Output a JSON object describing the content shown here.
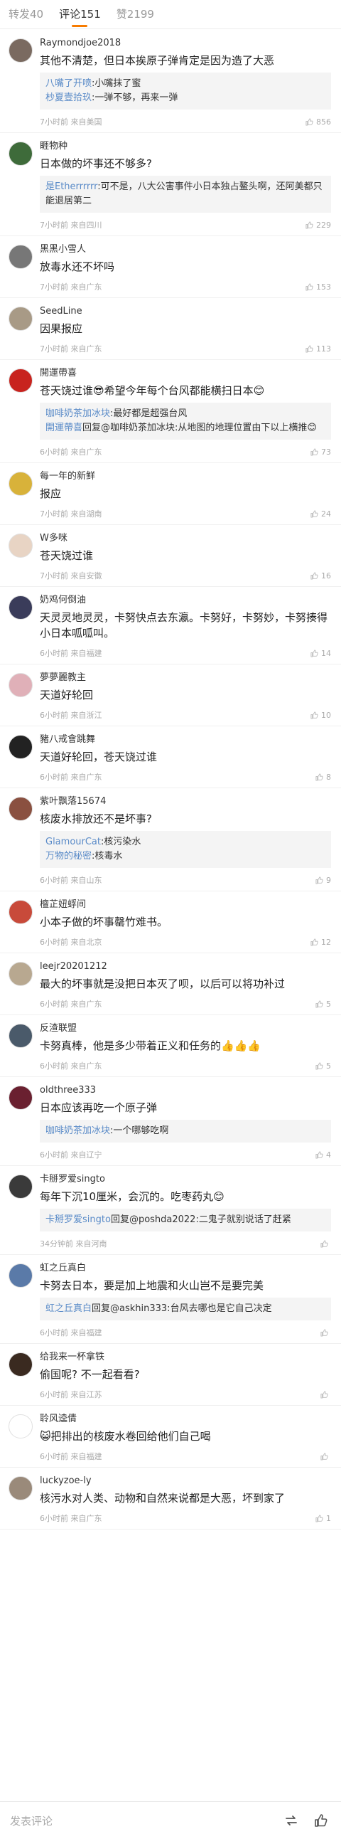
{
  "tabs": [
    {
      "label": "转发",
      "count": "40"
    },
    {
      "label": "评论",
      "count": "151"
    },
    {
      "label": "赞",
      "count": "2199"
    }
  ],
  "comments": [
    {
      "name": "Raymondjoe2018",
      "text": "其他不清楚，但日本挨原子弹肯定是因为造了大恶",
      "replies": [
        {
          "name": "八嘴了开喷",
          "text": ":小嘴抹了蜜"
        },
        {
          "name": "杪夏壹拾玖",
          "text": ":一弹不够，再来一弹"
        }
      ],
      "meta": "7小时前 来自美国",
      "likes": "856",
      "avatar_color": "#7a6a60"
    },
    {
      "name": "睚物种",
      "text": "日本做的坏事还不够多?",
      "replies": [
        {
          "name": "是Etherrrrrr",
          "text": ":可不是，八大公害事件小日本独占鳌头啊，还阿美都只能退居第二"
        }
      ],
      "meta": "7小时前 来自四川",
      "likes": "229",
      "avatar_color": "#3e6b3a"
    },
    {
      "name": "黑黑小雪人",
      "text": "放毒水还不坏吗",
      "replies": [],
      "meta": "7小时前 来自广东",
      "likes": "153",
      "avatar_color": "#777777"
    },
    {
      "name": "SeedLine",
      "text": "因果报应",
      "replies": [],
      "meta": "7小时前 来自广东",
      "likes": "113",
      "avatar_color": "#a89a86"
    },
    {
      "name": "開運帶喜",
      "text": "苍天饶过谁😎希望今年每个台风都能横扫日本😊",
      "replies": [
        {
          "name": "咖啡奶茶加冰块",
          "text": ":最好都是超强台风"
        },
        {
          "name": "開運帶喜",
          "text": "回复@咖啡奶茶加冰块:从地图的地理位置由下以上横推😊"
        }
      ],
      "meta": "6小时前 来自广东",
      "likes": "73",
      "avatar_color": "#c8231e"
    },
    {
      "name": "每一年的新鲜",
      "text": "报应",
      "replies": [],
      "meta": "7小时前 来自湖南",
      "likes": "24",
      "avatar_color": "#d8b23a"
    },
    {
      "name": "W多咪",
      "text": "苍天饶过谁",
      "replies": [],
      "meta": "7小时前 来自安徽",
      "likes": "16",
      "avatar_color": "#e8d4c4"
    },
    {
      "name": "奶鸡何倒油",
      "text": "天灵灵地灵灵，卡努快点去东瀛。卡努好，卡努妙，卡努揍得小日本呱呱叫。",
      "replies": [],
      "meta": "6小时前 来自福建",
      "likes": "14",
      "avatar_color": "#3a3c5a"
    },
    {
      "name": "夢夢麗教主",
      "text": "天道好轮回",
      "replies": [],
      "meta": "6小时前 来自浙江",
      "likes": "10",
      "avatar_color": "#e0b0b8"
    },
    {
      "name": "豬八戒會跳舞",
      "text": "天道好轮回，苍天饶过谁",
      "replies": [],
      "meta": "6小时前 来自广东",
      "likes": "8",
      "avatar_color": "#222222"
    },
    {
      "name": "紫叶飘落15674",
      "text": "核废水排放还不是坏事?",
      "replies": [
        {
          "name": "GlamourCat",
          "text": ":核污染水"
        },
        {
          "name": "万物的秘密",
          "text": ":核毒水"
        }
      ],
      "meta": "6小时前 来自山东",
      "likes": "9",
      "avatar_color": "#8a5040"
    },
    {
      "name": "檀芷妞蜉间",
      "text": "小本子做的坏事罄竹难书。",
      "replies": [],
      "meta": "6小时前 来自北京",
      "likes": "12",
      "avatar_color": "#c84a3a"
    },
    {
      "name": "leejr20201212",
      "text": "最大的坏事就是没把日本灭了呗，以后可以将功补过",
      "replies": [],
      "meta": "6小时前 来自广东",
      "likes": "5",
      "avatar_color": "#b8a890"
    },
    {
      "name": "反渣联盟",
      "text": "卡努真棒，他是多少带着正义和任务的👍👍👍",
      "replies": [],
      "meta": "6小时前 来自广东",
      "likes": "5",
      "avatar_color": "#4a5a6a"
    },
    {
      "name": "oldthree333",
      "text": "日本应该再吃一个原子弹",
      "replies": [
        {
          "name": "咖啡奶茶加冰块",
          "text": ":一个哪够吃啊"
        }
      ],
      "meta": "6小时前 来自辽宁",
      "likes": "4",
      "avatar_color": "#6a2030"
    },
    {
      "name": "卡掰罗爱singto",
      "text": "每年下沉10厘米，会沉的。吃枣药丸😊",
      "replies": [
        {
          "name": "卡掰罗爱singto",
          "text": "回复@poshda2022:二鬼子就别说话了赶紧"
        }
      ],
      "meta": "34分钟前 来自河南",
      "likes": "",
      "avatar_color": "#3a3a3a"
    },
    {
      "name": "虹之丘真白",
      "text": "卡努去日本，要是加上地震和火山岂不是要完美",
      "replies": [
        {
          "name": "虹之丘真白",
          "text": "回复@askhin333:台风去哪也是它自己决定"
        }
      ],
      "meta": "6小时前 来自福建",
      "likes": "",
      "avatar_color": "#5a7aa8"
    },
    {
      "name": "给我来一杯拿铁",
      "text": "偷国呢? 不一起看看?",
      "replies": [],
      "meta": "6小时前 来自江苏",
      "likes": "",
      "avatar_color": "#3a2a20"
    },
    {
      "name": "聆风逵倩",
      "text": "😺把排出的核废水卷回给他们自己喝",
      "replies": [],
      "meta": "6小时前 来自福建",
      "likes": "",
      "avatar_color": "#ffffff"
    },
    {
      "name": "luckyzoe-ly",
      "text": "核污水对人类、动物和自然来说都是大恶，坏到家了",
      "replies": [],
      "meta": "6小时前 来自广东",
      "likes": "1",
      "avatar_color": "#9a8a7a"
    }
  ],
  "bottom_bar": {
    "placeholder": "发表评论"
  }
}
